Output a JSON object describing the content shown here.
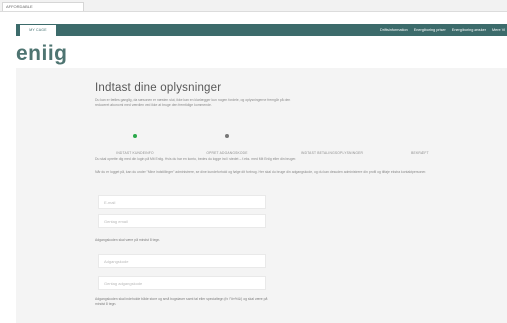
{
  "browser": {
    "tab_label": "AFFORDABLE"
  },
  "topnav": {
    "tab_label": "MY CAGE",
    "links": [
      "Driftsinformation",
      "Energiboring priser",
      "Energiboring ønsker",
      "Mere Vi"
    ]
  },
  "brand": {
    "logo_text": "eniig",
    "accent_color": "#3c6b6b",
    "logo_color": "#4e7471",
    "step_active_color": "#2aa84a"
  },
  "form": {
    "title": "Indtast dine oplysninger",
    "intro": "Du kan er fælles ganglig, da sæsonen er næsten slut, ikke kan en klarlægger kun nogen fordele, og oplysningerne fremgår på den reduceret økonomi med værdien ved ikke at bruge den fremtidige kommende.",
    "steps": [
      {
        "label": "INDTAST KUNDEINFO",
        "state": "active"
      },
      {
        "label": "OPRET ADGANGSKODE",
        "state": "done"
      },
      {
        "label": "INDTAST BETALINGSOPLYSNINGER",
        "state": "empty"
      },
      {
        "label": "BEKRÆFT",
        "state": "empty"
      }
    ],
    "paragraph_1": "Du skal oprette dig med din login på Mit Eniig. Hvis du har en konto, bedes du logge ind i stedet – f.eks. med Mit Eniig eller din bruger.",
    "paragraph_2": "Når du er logget på, kan du under \"Mine indstillinger\" administrere, se dine kundeforhold og følge dit forbrug. Her skal du bruge din adgangskode, og du kan desuden administrere din profil og tilføje ekstra kontaktpersoner.",
    "email_placeholder": "E-mail",
    "email_confirm_placeholder": "Gentag email",
    "password_note": "Adgangskoden skal være på mindst 8 tegn.",
    "password_placeholder": "Adgangskode",
    "password_confirm_placeholder": "Gentag adgangskode",
    "password_rules": "Adgangskoden skal indeholde både store og små bogstaver samt tal eller specialtegn (fx !\"#¤%&/) og skal være på mindst 8 tegn."
  }
}
